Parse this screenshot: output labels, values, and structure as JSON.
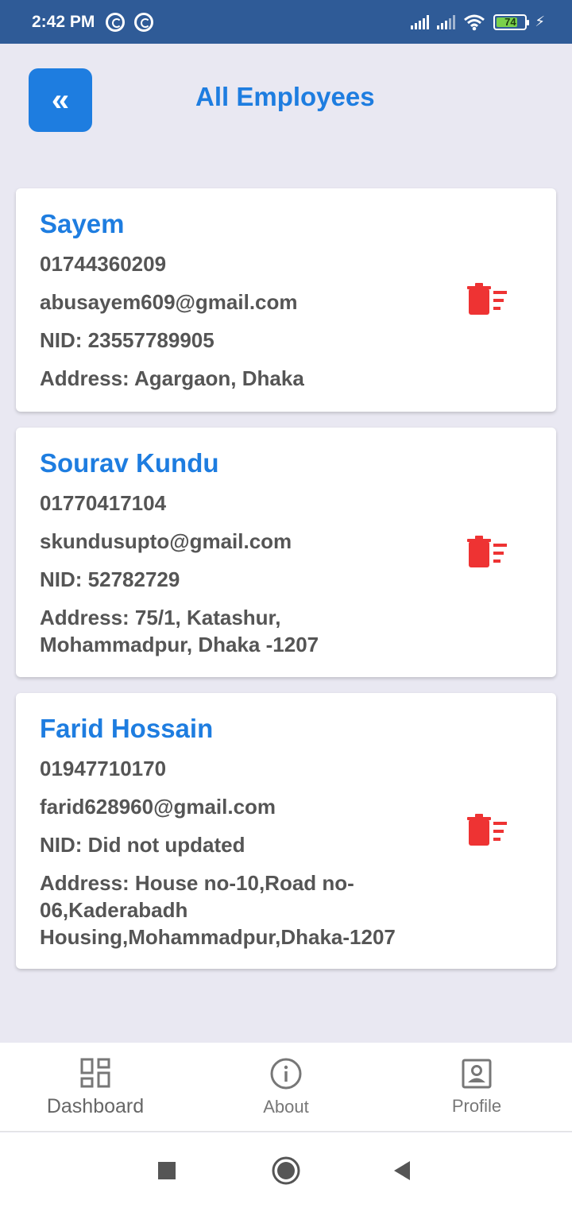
{
  "status_bar": {
    "time": "2:42 PM",
    "battery_level": "74",
    "battery_fraction": 0.74,
    "icons": [
      "vpn-icon",
      "vpn-icon",
      "signal-icon",
      "signal-icon",
      "wifi-icon",
      "battery-icon",
      "charging-icon"
    ]
  },
  "header": {
    "back_icon": "«",
    "title": "All Employees"
  },
  "employees": [
    {
      "name": "Sayem",
      "phone": "01744360209",
      "email": "abusayem609@gmail.com",
      "nid": "NID: 23557789905",
      "address": "Address: Agargaon, Dhaka"
    },
    {
      "name": "Sourav Kundu",
      "phone": "01770417104",
      "email": "skundusupto@gmail.com",
      "nid": "NID: 52782729",
      "address": "Address: 75/1, Katashur, Mohammadpur, Dhaka -1207"
    },
    {
      "name": "Farid Hossain",
      "phone": "01947710170",
      "email": "farid628960@gmail.com",
      "nid": "NID: Did not updated",
      "address": "Address: House no-10,Road no-06,Kaderabadh Housing,Mohammadpur,Dhaka-1207"
    }
  ],
  "bottom_nav": {
    "items": [
      {
        "label": "Dashboard",
        "icon": "dashboard-icon",
        "active": true
      },
      {
        "label": "About",
        "icon": "info-icon",
        "active": false
      },
      {
        "label": "Profile",
        "icon": "profile-icon",
        "active": false
      }
    ]
  },
  "colors": {
    "accent": "#1e7de0",
    "status_bar": "#2f5b97",
    "background": "#e9e8f2",
    "delete": "#ee3333",
    "text": "#555555"
  }
}
